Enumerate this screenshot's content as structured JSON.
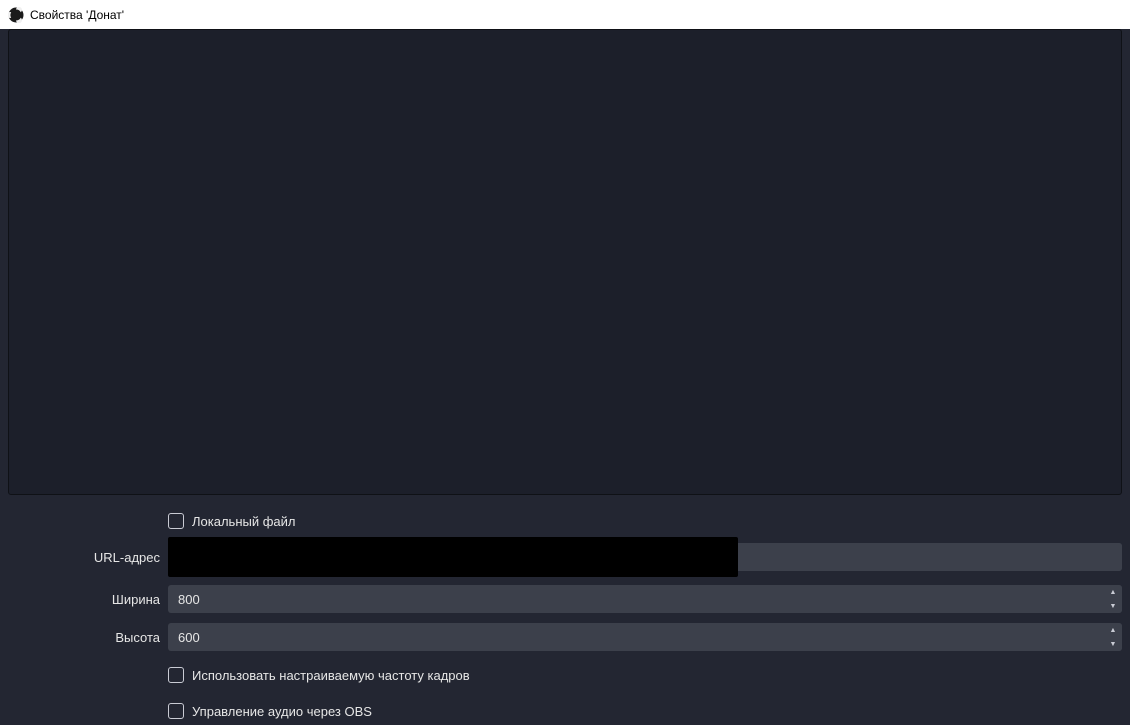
{
  "window": {
    "title": "Свойства 'Донат'"
  },
  "form": {
    "local_file": {
      "label": "Локальный файл"
    },
    "url": {
      "label": "URL-адрес",
      "value": ""
    },
    "width": {
      "label": "Ширина",
      "value": "800"
    },
    "height": {
      "label": "Высота",
      "value": "600"
    },
    "custom_fps": {
      "label": "Использовать настраиваемую частоту кадров"
    },
    "audio_via_obs": {
      "label": "Управление аудио через OBS"
    }
  }
}
